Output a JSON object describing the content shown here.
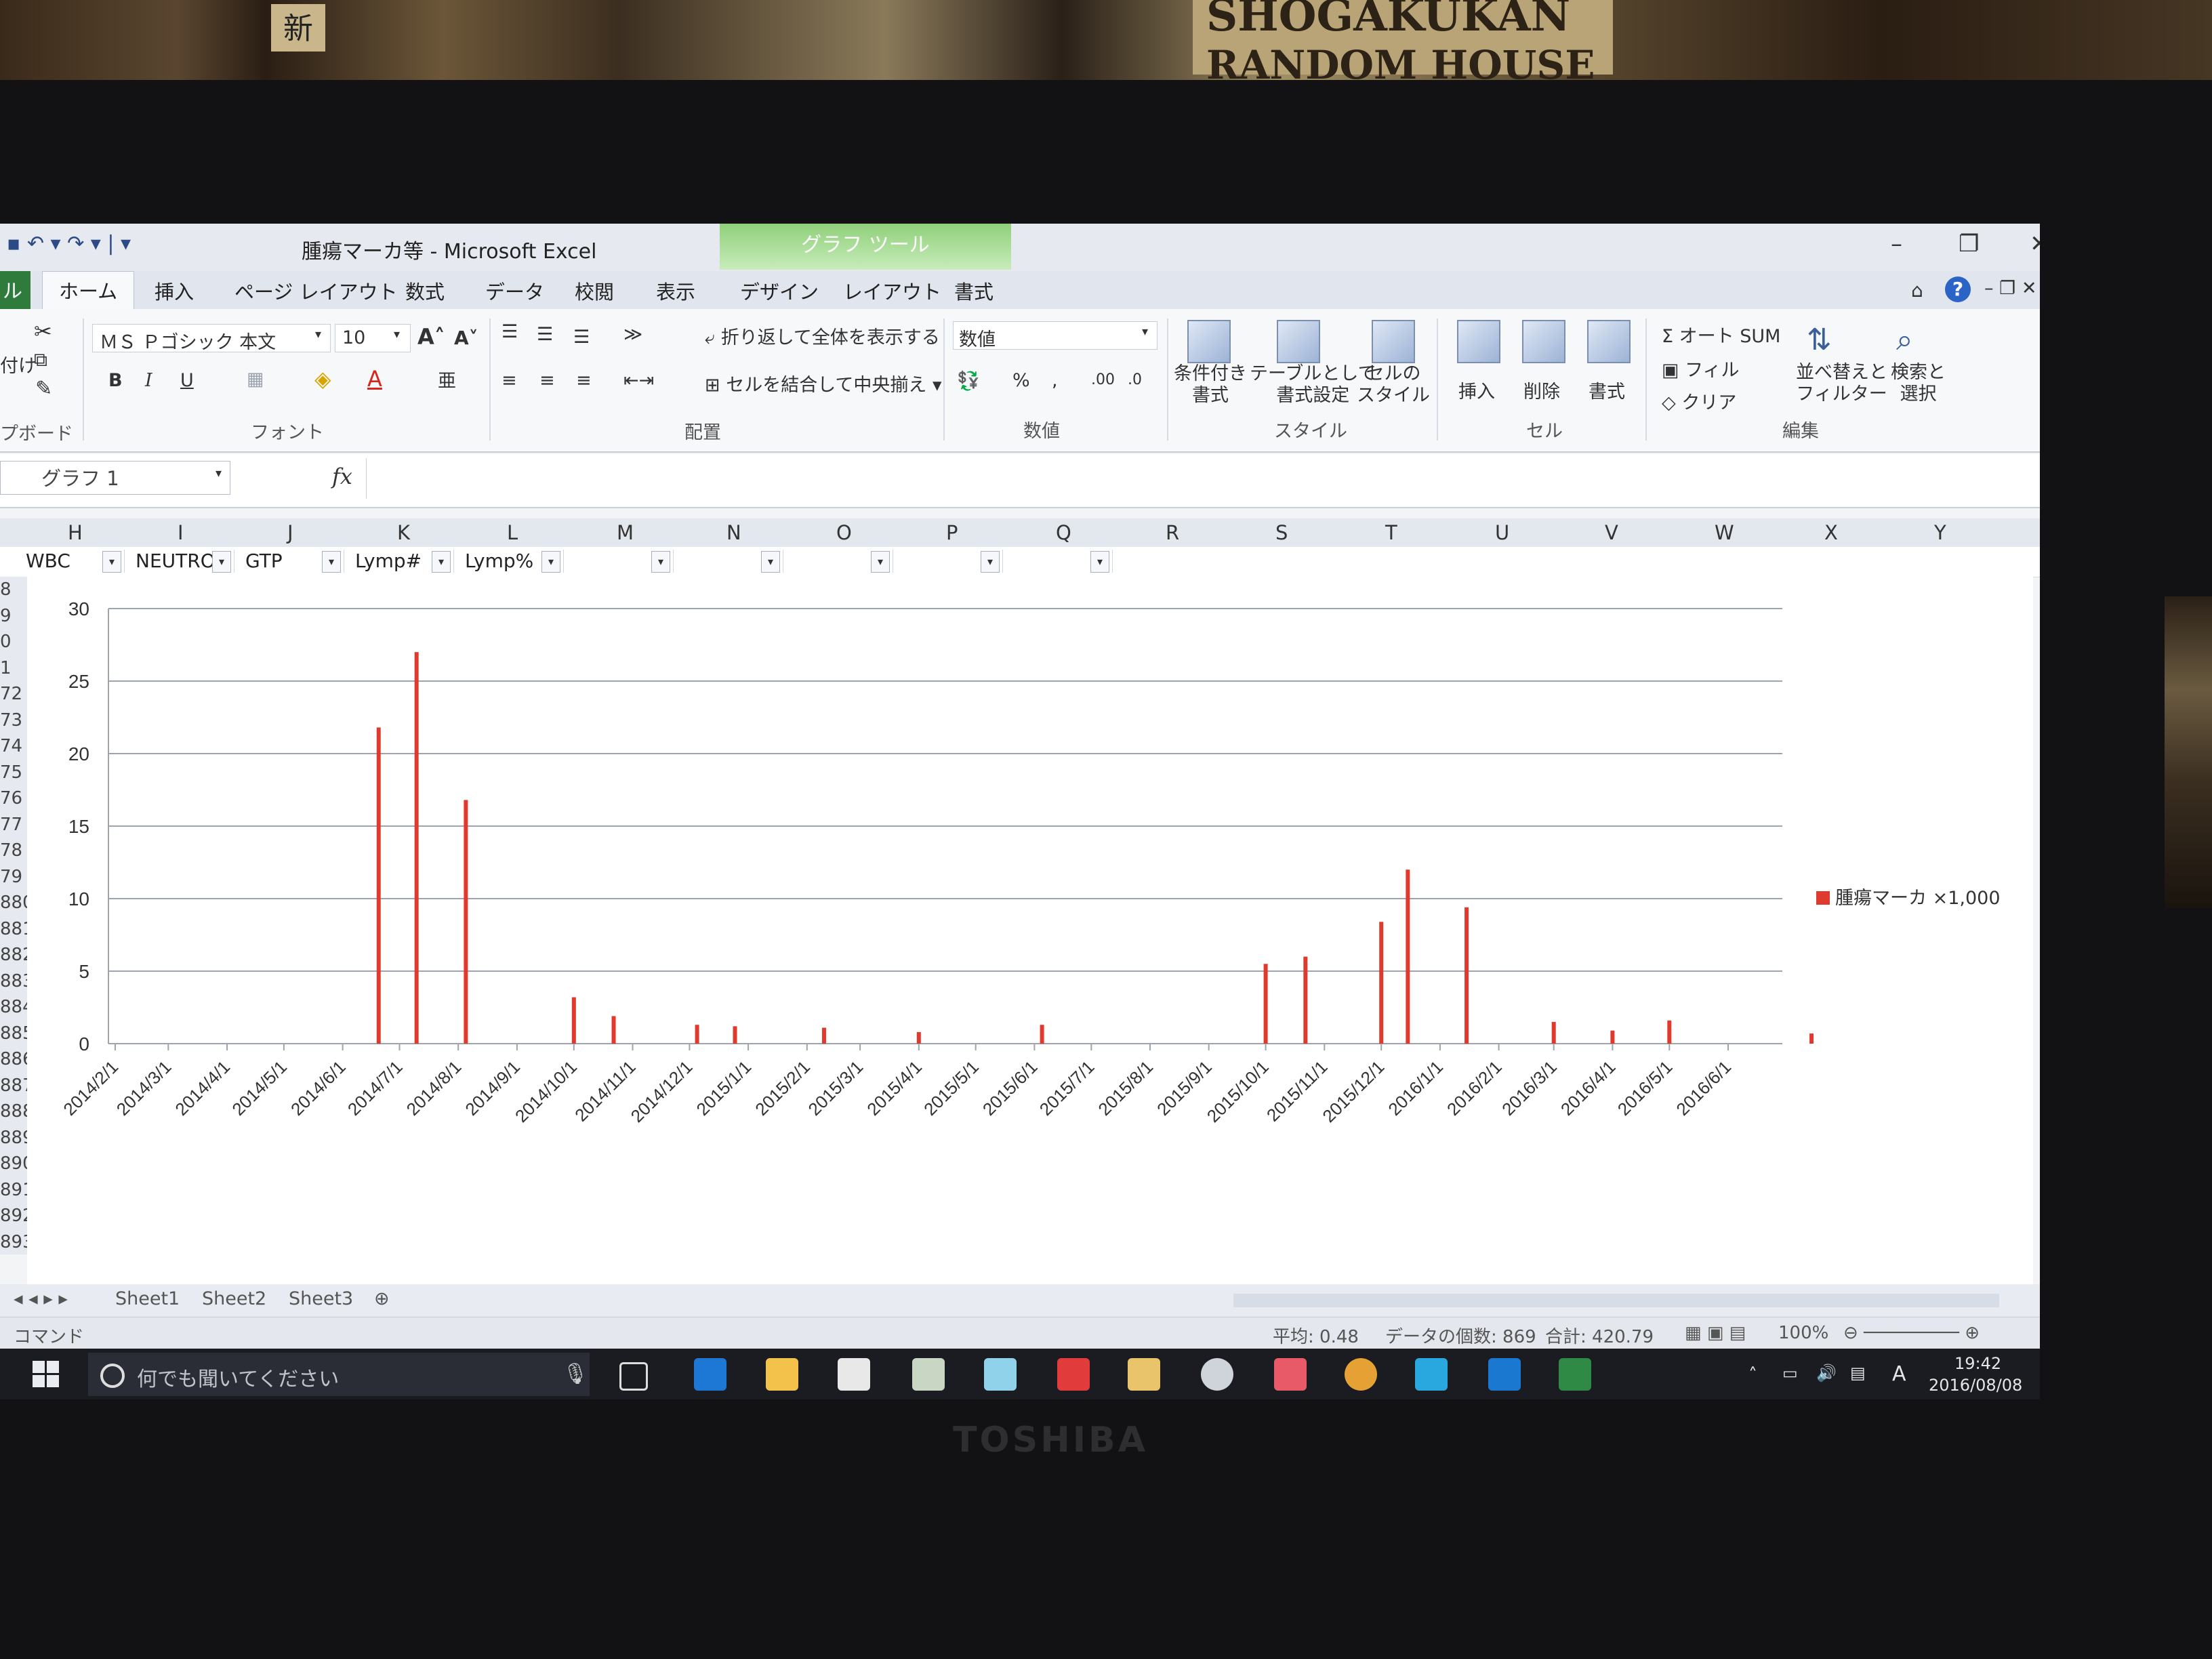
{
  "environment": {
    "book_title_1": "SHOGAKUKAN",
    "book_title_2": "RANDOM HOUSE",
    "book_kanji": "新",
    "laptop_brand": "TOSHIBA"
  },
  "window": {
    "title": "腫瘍マーカ等 - Microsoft Excel",
    "context_tab_group": "グラフ ツール",
    "controls": [
      "–",
      "❐",
      "✕"
    ]
  },
  "tabs": {
    "file": "ル",
    "items": [
      "ホーム",
      "挿入",
      "ページ レイアウト",
      "数式",
      "データ",
      "校閲",
      "表示",
      "デザイン",
      "レイアウト",
      "書式"
    ],
    "active_index": 0
  },
  "ribbon": {
    "clipboard_label": "プボード",
    "paste_fragment": "付け",
    "font_name": "ＭＳ Ｐゴシック 本文",
    "font_size": "10",
    "font_group": "フォント",
    "align_group": "配置",
    "wrap_text": "折り返して全体を表示する",
    "merge_center": "セルを結合して中央揃え",
    "number_format": "数値",
    "number_group": "数値",
    "cond_format": "条件付き\n書式",
    "table_format": "テーブルとして\n書式設定",
    "cell_style": "セルの\nスタイル",
    "style_group": "スタイル",
    "insert": "挿入",
    "delete": "削除",
    "format": "書式",
    "cells_group": "セル",
    "autosum": "Σ オート SUM",
    "fill": "フィル",
    "clear": "クリア",
    "sort_filter": "並べ替えと\nフィルター",
    "find_select": "検索と\n選択",
    "edit_group": "編集"
  },
  "formula_bar": {
    "name_box": "グラフ 1",
    "fx": "fx"
  },
  "columns": [
    "H",
    "I",
    "J",
    "K",
    "L",
    "M",
    "N",
    "O",
    "P",
    "Q",
    "R",
    "S",
    "T",
    "U",
    "V",
    "W",
    "X",
    "Y"
  ],
  "filter_headers": [
    "WBC",
    "NEUTRO",
    "GTP",
    "Lymp#",
    "Lymp%",
    "",
    "",
    "",
    "",
    ""
  ],
  "row_numbers": [
    "8",
    "9",
    "0",
    "1",
    "72",
    "73",
    "74",
    "75",
    "76",
    "77",
    "78",
    "79",
    "880",
    "881",
    "882",
    "883",
    "884",
    "885",
    "886",
    "887",
    "888",
    "889",
    "890",
    "891",
    "892",
    "893"
  ],
  "chart_data": {
    "type": "bar",
    "ylim": [
      0,
      30
    ],
    "yticks": [
      0,
      5,
      10,
      15,
      20,
      25,
      30
    ],
    "grid": true,
    "legend_position": "right",
    "x_tick_labels": [
      "2014/2/1",
      "2014/3/1",
      "2014/4/1",
      "2014/5/1",
      "2014/6/1",
      "2014/7/1",
      "2014/8/1",
      "2014/9/1",
      "2014/10/1",
      "2014/11/1",
      "2014/12/1",
      "2015/1/1",
      "2015/2/1",
      "2015/3/1",
      "2015/4/1",
      "2015/5/1",
      "2015/6/1",
      "2015/7/1",
      "2015/8/1",
      "2015/9/1",
      "2015/10/1",
      "2015/11/1",
      "2015/12/1",
      "2016/1/1",
      "2016/2/1",
      "2016/3/1",
      "2016/4/1",
      "2016/5/1",
      "2016/6/1"
    ],
    "series": [
      {
        "name": "腫瘍マーカ ×1,000",
        "color": "#e03a2f",
        "points": [
          {
            "x": "2014/6/20",
            "y": 21.8
          },
          {
            "x": "2014/7/10",
            "y": 27.0
          },
          {
            "x": "2014/8/5",
            "y": 16.8
          },
          {
            "x": "2014/10/1",
            "y": 3.2
          },
          {
            "x": "2014/10/22",
            "y": 1.9
          },
          {
            "x": "2014/12/5",
            "y": 1.3
          },
          {
            "x": "2014/12/25",
            "y": 1.2
          },
          {
            "x": "2015/2/10",
            "y": 1.1
          },
          {
            "x": "2015/4/1",
            "y": 0.8
          },
          {
            "x": "2015/6/5",
            "y": 1.3
          },
          {
            "x": "2015/10/1",
            "y": 5.5
          },
          {
            "x": "2015/10/22",
            "y": 6.0
          },
          {
            "x": "2015/12/1",
            "y": 8.4
          },
          {
            "x": "2015/12/15",
            "y": 12.0
          },
          {
            "x": "2016/1/15",
            "y": 9.4
          },
          {
            "x": "2016/3/1",
            "y": 1.5
          },
          {
            "x": "2016/4/1",
            "y": 0.9
          },
          {
            "x": "2016/5/1",
            "y": 1.6
          },
          {
            "x": "2016/7/15",
            "y": 0.7
          }
        ]
      }
    ]
  },
  "sheets": [
    "Sheet1",
    "Sheet2",
    "Sheet3"
  ],
  "status_bar": {
    "mode": "コマンド",
    "average": "平均: 0.48",
    "count": "データの個数: 869",
    "sum": "合計: 420.79",
    "zoom": "100%"
  },
  "taskbar": {
    "search_placeholder": "何でも聞いてください",
    "time": "19:42",
    "date": "2016/08/08",
    "ime": "A"
  }
}
